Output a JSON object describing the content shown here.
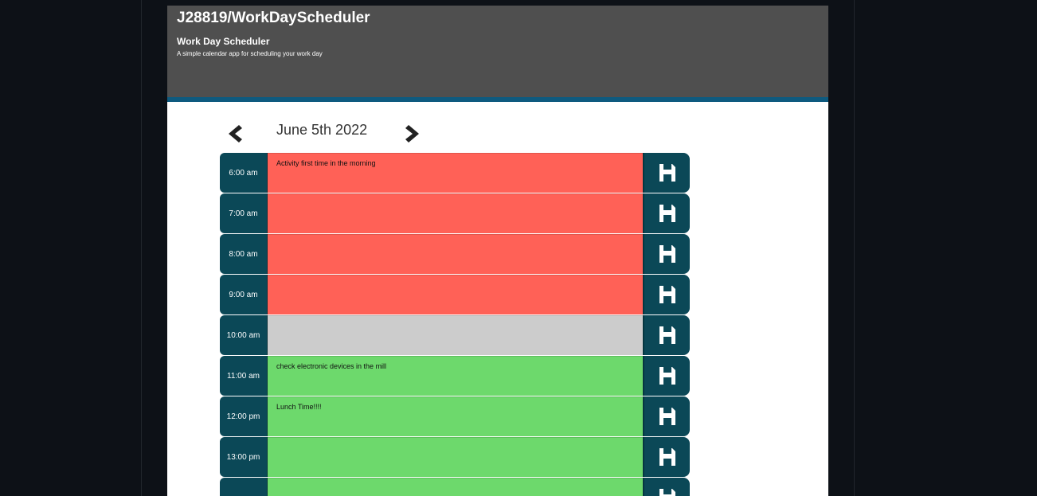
{
  "header": {
    "repo_title": "J28819/WorkDayScheduler",
    "app_title": "Work Day Scheduler",
    "subtitle": "A simple calendar app for scheduling your work day"
  },
  "nav": {
    "date": "June 5th 2022",
    "prev_icon": "chevron-left-icon",
    "next_icon": "chevron-right-icon"
  },
  "colors": {
    "past": "#ff6157",
    "present": "#cccccc",
    "future": "#6dd96c",
    "hour_bg": "#0b4857",
    "banner": "#4f4f4f",
    "banner_accent": "#0e5a7f"
  },
  "rows": [
    {
      "hour": "6:00 am",
      "text": "Activity first time in the morning",
      "state": "past"
    },
    {
      "hour": "7:00 am",
      "text": "",
      "state": "past"
    },
    {
      "hour": "8:00 am",
      "text": "",
      "state": "past"
    },
    {
      "hour": "9:00 am",
      "text": "",
      "state": "past"
    },
    {
      "hour": "10:00 am",
      "text": "",
      "state": "present"
    },
    {
      "hour": "11:00 am",
      "text": "check electronic devices in the mill",
      "state": "future"
    },
    {
      "hour": "12:00 pm",
      "text": "Lunch Time!!!!",
      "state": "future"
    },
    {
      "hour": "13:00 pm",
      "text": "",
      "state": "future"
    },
    {
      "hour": "",
      "text": "",
      "state": "future"
    }
  ],
  "save_icon": "floppy-disk-icon"
}
